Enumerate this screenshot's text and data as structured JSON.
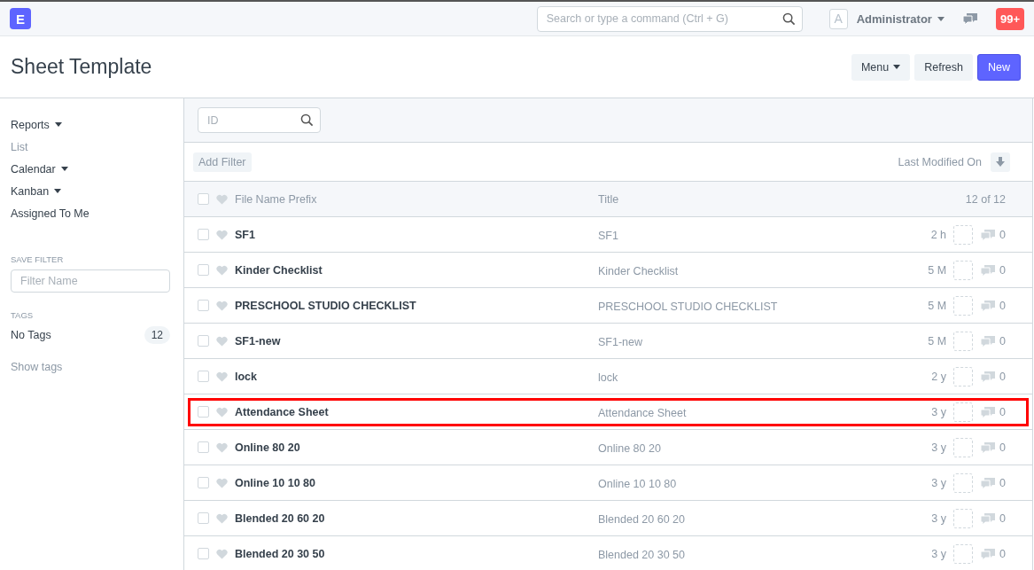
{
  "navbar": {
    "logo": "E",
    "search": {
      "placeholder": "Search or type a command (Ctrl + G)"
    },
    "avatar": "A",
    "user": "Administrator",
    "notifications": "99+"
  },
  "page": {
    "title": "Sheet Template",
    "buttons": [
      {
        "label": "Menu",
        "kind": "dropdown"
      },
      {
        "label": "Refresh",
        "kind": "default"
      },
      {
        "label": "New",
        "kind": "primary"
      }
    ]
  },
  "sidebar": {
    "items": [
      {
        "label": "Reports",
        "dropdown": true,
        "selected": false
      },
      {
        "label": "List",
        "dropdown": false,
        "selected": true
      },
      {
        "label": "Calendar",
        "dropdown": true,
        "selected": false
      },
      {
        "label": "Kanban",
        "dropdown": true,
        "selected": false
      },
      {
        "label": "Assigned To Me",
        "dropdown": false,
        "selected": false
      }
    ],
    "save_filter": {
      "heading": "SAVE FILTER",
      "placeholder": "Filter Name"
    },
    "tags": {
      "heading": "TAGS",
      "items": [
        {
          "label": "No Tags",
          "count": "12"
        }
      ],
      "show_tags": "Show tags"
    }
  },
  "list": {
    "id_filter": {
      "placeholder": "ID"
    },
    "add_filter": "Add Filter",
    "sort": "Last Modified On",
    "columns": [
      "File Name Prefix",
      "Title"
    ],
    "count": "12 of 12",
    "select_all": {
      "checked": false
    },
    "rows": [
      {
        "name": "SF1",
        "title": "SF1",
        "modified": "2 h",
        "comments": "0",
        "highlighted": false
      },
      {
        "name": "Kinder Checklist",
        "title": "Kinder Checklist",
        "modified": "5 M",
        "comments": "0",
        "highlighted": false
      },
      {
        "name": "PRESCHOOL STUDIO CHECKLIST",
        "title": "PRESCHOOL STUDIO CHECKLIST",
        "modified": "5 M",
        "comments": "0",
        "highlighted": false
      },
      {
        "name": "SF1-new",
        "title": "SF1-new",
        "modified": "5 M",
        "comments": "0",
        "highlighted": false
      },
      {
        "name": "lock",
        "title": "lock",
        "modified": "2 y",
        "comments": "0",
        "highlighted": false
      },
      {
        "name": "Attendance Sheet",
        "title": "Attendance Sheet",
        "modified": "3 y",
        "comments": "0",
        "highlighted": true
      },
      {
        "name": "Online 80 20",
        "title": "Online 80 20",
        "modified": "3 y",
        "comments": "0",
        "highlighted": false
      },
      {
        "name": "Online 10 10 80",
        "title": "Online 10 10 80",
        "modified": "3 y",
        "comments": "0",
        "highlighted": false
      },
      {
        "name": "Blended 20 60 20",
        "title": "Blended 20 60 20",
        "modified": "3 y",
        "comments": "0",
        "highlighted": false
      },
      {
        "name": "Blended 20 30 50",
        "title": "Blended 20 30 50",
        "modified": "3 y",
        "comments": "0",
        "highlighted": false
      }
    ]
  }
}
